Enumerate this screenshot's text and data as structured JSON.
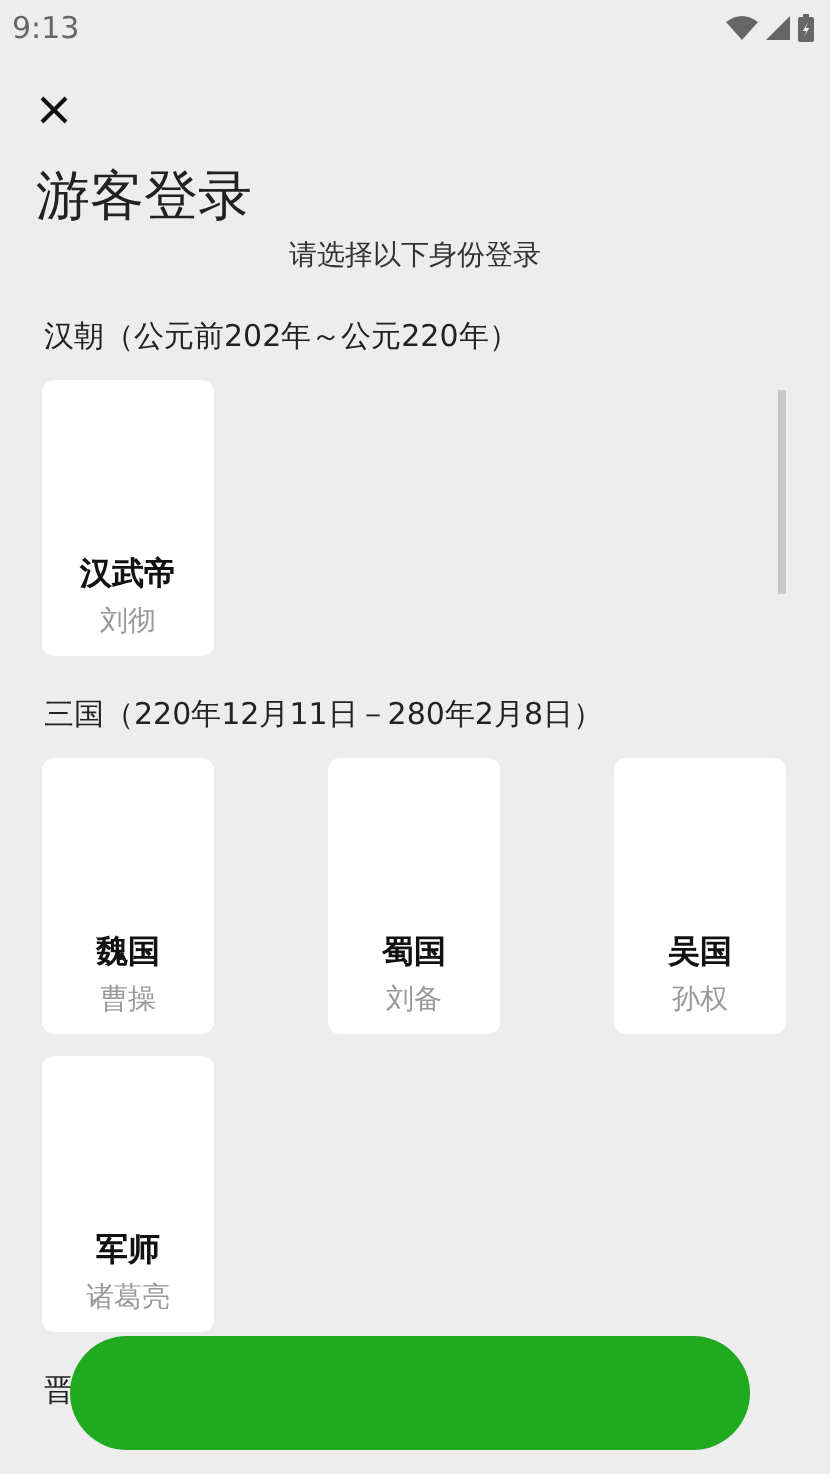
{
  "status_bar": {
    "time": "9:13"
  },
  "title": "游客登录",
  "subtitle": "请选择以下身份登录",
  "sections": [
    {
      "label": "汉朝（公元前202年～公元220年）",
      "cards": [
        {
          "name": "汉武帝",
          "person": "刘彻"
        }
      ]
    },
    {
      "label": "三国（220年12月11日－280年2月8日）",
      "cards": [
        {
          "name": "魏国",
          "person": "曹操"
        },
        {
          "name": "蜀国",
          "person": "刘备"
        },
        {
          "name": "吴国",
          "person": "孙权"
        },
        {
          "name": "军师",
          "person": "诸葛亮"
        }
      ]
    },
    {
      "label": "晋"
    }
  ]
}
